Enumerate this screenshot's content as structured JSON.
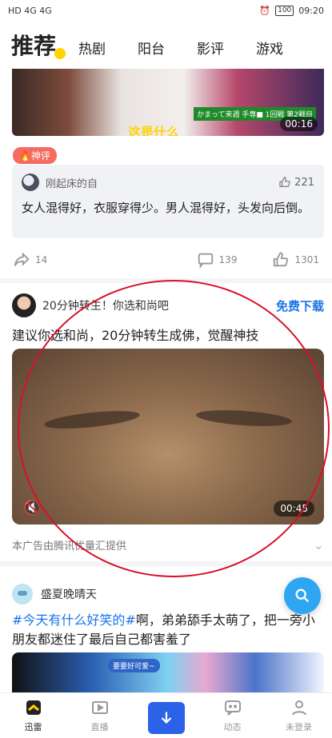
{
  "status_bar": {
    "left": "HD 4G 4G",
    "battery": "100",
    "time": "09:20"
  },
  "top_nav": {
    "active": "推荐",
    "tabs": [
      "热剧",
      "阳台",
      "影评",
      "游戏"
    ]
  },
  "video1": {
    "duration": "00:16",
    "caption": "这是什么",
    "jp_badge": "かまって来週 手専■ 1回戦 第2戦目"
  },
  "hot_tag": "神评",
  "comment": {
    "user": "刚起床的自",
    "likes": "221",
    "text": "女人混得好，衣服穿得少。男人混得好，头发向后倒。"
  },
  "actions": {
    "share": "14",
    "comments": "139",
    "likes": "1301"
  },
  "ad": {
    "name": "20分钟转生！你选和尚吧",
    "cta": "免费下载",
    "title": "建议你选和尚，20分钟转生成佛，觉醒神技",
    "duration": "00:45",
    "source": "本广告由腾讯优量汇提供"
  },
  "post": {
    "user": "盛夏晚晴天",
    "hashtag": "#今天有什么好笑的#",
    "text": "啊，弟弟舔手太萌了，把一旁小朋友都迷住了最后自己都害羞了",
    "thumb_sign": "要要好可爱~"
  },
  "bottom_nav": [
    {
      "label": "迅雷",
      "icon": "home-icon"
    },
    {
      "label": "直播",
      "icon": "video-icon"
    },
    {
      "label": "",
      "icon": "download-icon"
    },
    {
      "label": "动态",
      "icon": "chat-icon"
    },
    {
      "label": "未登录",
      "icon": "user-icon"
    }
  ],
  "colors": {
    "accent": "#1a74e8",
    "brand_yellow": "#ffd400",
    "hot_tag": "#f56b5f",
    "fab": "#2ea6f2",
    "annotation": "#d8102a"
  }
}
